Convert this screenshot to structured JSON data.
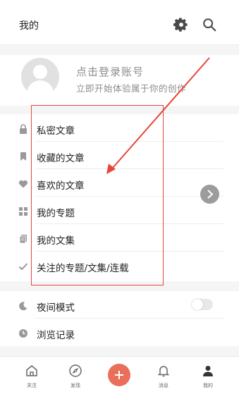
{
  "header": {
    "title": "我的",
    "settings_icon": "gear-icon",
    "search_icon": "search-icon"
  },
  "profile": {
    "title": "点击登录账号",
    "subtitle": "立即开始体验属于你的创作",
    "avatar_icon": "avatar-placeholder-icon"
  },
  "menu": {
    "items": [
      {
        "label": "私密文章",
        "icon": "lock-icon"
      },
      {
        "label": "收藏的文章",
        "icon": "bookmark-icon"
      },
      {
        "label": "喜欢的文章",
        "icon": "heart-icon"
      },
      {
        "label": "我的专题",
        "icon": "grid-icon"
      },
      {
        "label": "我的文集",
        "icon": "collection-icon"
      },
      {
        "label": "关注的专题/文集/连载",
        "icon": "check-icon"
      }
    ]
  },
  "settings": {
    "items": [
      {
        "label": "夜间模式",
        "icon": "moon-icon"
      },
      {
        "label": "浏览记录",
        "icon": "clock-icon"
      }
    ],
    "night_mode_on": false
  },
  "tabbar": {
    "tabs": [
      {
        "label": "关注",
        "icon": "home-icon"
      },
      {
        "label": "发现",
        "icon": "compass-icon"
      },
      {
        "label": "",
        "icon": "plus-icon"
      },
      {
        "label": "消息",
        "icon": "bell-icon"
      },
      {
        "label": "我的",
        "icon": "person-icon"
      }
    ]
  },
  "colors": {
    "accent": "#ea6f5a",
    "annotation": "#e8463c"
  }
}
